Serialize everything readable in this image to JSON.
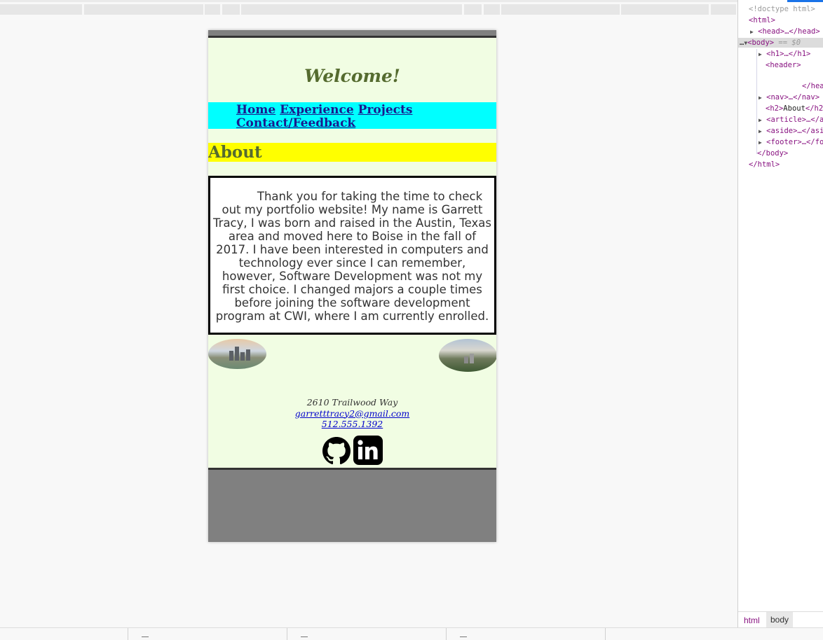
{
  "page": {
    "title": "Welcome!",
    "nav": [
      "Home",
      "Experience",
      "Projects",
      "Contact/Feedback"
    ],
    "section_heading": "About",
    "about_text": "Thank you for taking the time to check out my portfolio website! My name is Garrett Tracy, I was born and raised in the Austin, Texas area and moved here to Boise in the fall of 2017. I have been interested in computers and technology ever since I can remember, however, Software Development was not my first choice. I changed majors a couple times before joining the software development program at CWI, where I am currently enrolled.",
    "footer": {
      "address": "2610 Trailwood Way",
      "email": "garretttracy2@gmail.com",
      "phone": "512.555.1392"
    },
    "social_icons": [
      "github-icon",
      "linkedin-icon"
    ],
    "colors": {
      "page_bg": "#f1fde3",
      "nav_bg": "#00ffff",
      "heading_bg": "#ffff00",
      "heading_text": "#556b2f",
      "frame": "#808080"
    }
  },
  "devtools": {
    "lines": {
      "doctype": "<!doctype html>",
      "html_open": "<html>",
      "head": "<head>…</head>",
      "body": "<body>",
      "body_eq": " == $0",
      "h1": "<h1>…</h1>",
      "header_open": "<header>",
      "header_close": "</heade",
      "nav": "<nav>…</nav>",
      "h2_open": "<h2>",
      "h2_text": "About",
      "h2_close": "</h2",
      "article": "<article>…</a",
      "aside": "<aside>…</asi",
      "footer": "<footer>…</fo",
      "body_close": "</body>",
      "html_close": "</html>"
    },
    "breadcrumbs": [
      "html",
      "body"
    ]
  }
}
